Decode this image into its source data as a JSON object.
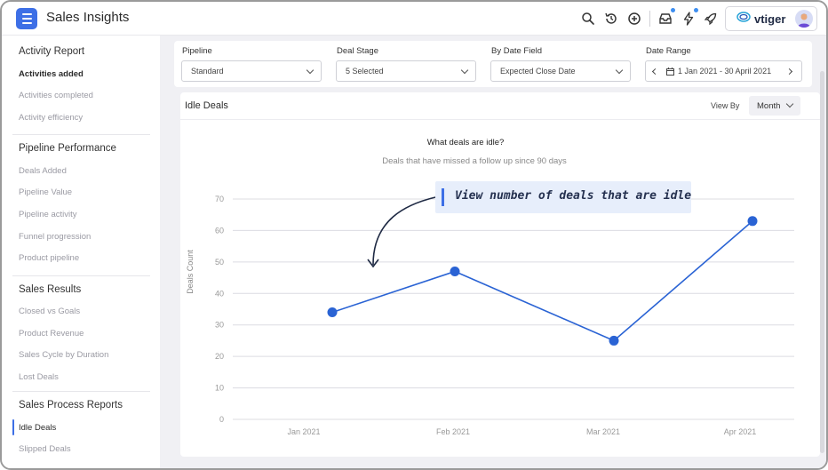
{
  "header": {
    "title": "Sales Insights",
    "brand": "vtiger",
    "icons": [
      "search-icon",
      "history-icon",
      "add-circle-icon",
      "inbox-icon",
      "bolt-icon",
      "rocket-icon"
    ],
    "accent": "#3d6fe6"
  },
  "sidebar": {
    "groups": [
      {
        "title": "Activity Report",
        "items": [
          "Activities added",
          "Activities completed",
          "Activity efficiency"
        ]
      },
      {
        "title": "Pipeline Performance",
        "items": [
          "Deals Added",
          "Pipeline Value",
          "Pipeline activity",
          "Funnel progression",
          "Product pipeline"
        ]
      },
      {
        "title": "Sales Results",
        "items": [
          "Closed vs Goals",
          "Product Revenue",
          "Sales Cycle by Duration",
          "Lost Deals"
        ]
      },
      {
        "title": "Sales Process Reports",
        "items": [
          "Idle Deals",
          "Slipped Deals"
        ]
      }
    ],
    "selected": "Idle Deals"
  },
  "filters": {
    "pipeline": {
      "label": "Pipeline",
      "value": "Standard"
    },
    "deal_stage": {
      "label": "Deal Stage",
      "value": "5 Selected"
    },
    "date_field": {
      "label": "By Date Field",
      "value": "Expected Close Date"
    },
    "date_range": {
      "label": "Date Range",
      "value": "1 Jan 2021 - 30 April 2021"
    }
  },
  "card": {
    "title": "Idle Deals",
    "view_by_label": "View By",
    "view_by_value": "Month"
  },
  "callout": {
    "text": "View number of deals that are idle"
  },
  "chart_data": {
    "type": "line",
    "title": "What deals are idle?",
    "subtitle": "Deals that have missed a follow up since 90 days",
    "ylabel": "Deals Count",
    "xlabel": "",
    "categories": [
      "Jan 2021",
      "Feb 2021",
      "Mar 2021",
      "Apr 2021"
    ],
    "series": [
      {
        "values": [
          34,
          47,
          25,
          63
        ]
      }
    ],
    "yticks": [
      0,
      10,
      20,
      30,
      40,
      50,
      60,
      70
    ],
    "ylim": [
      0,
      70
    ],
    "grid": true,
    "line_color": "#2a63d4"
  }
}
